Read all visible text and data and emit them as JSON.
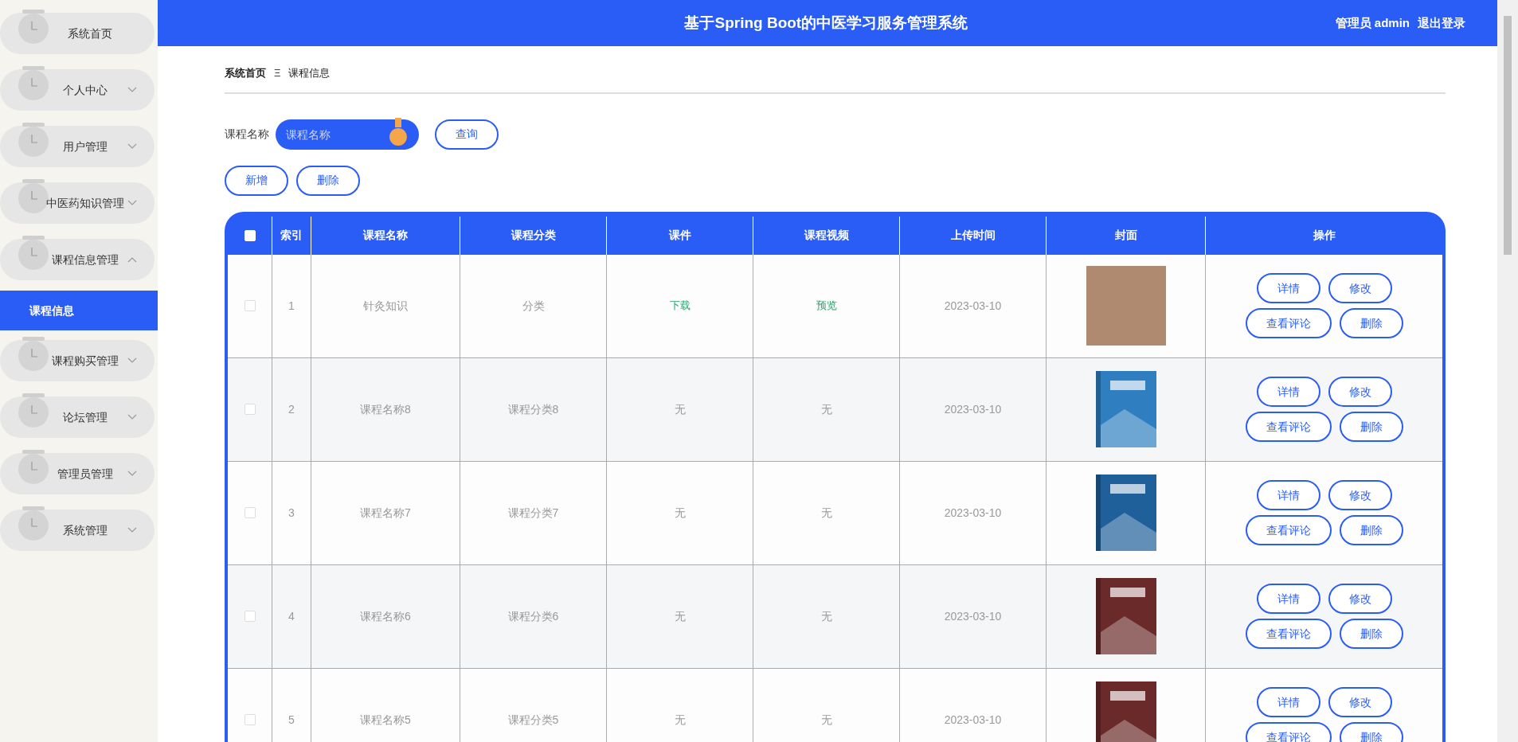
{
  "sidebar": {
    "items": [
      {
        "label": "系统首页",
        "has_children": false
      },
      {
        "label": "个人中心",
        "has_children": true,
        "expanded": false
      },
      {
        "label": "用户管理",
        "has_children": true,
        "expanded": false
      },
      {
        "label": "中医药知识管理",
        "has_children": true,
        "expanded": false
      },
      {
        "label": "课程信息管理",
        "has_children": true,
        "expanded": true,
        "children": [
          {
            "label": "课程信息",
            "selected": true
          }
        ]
      },
      {
        "label": "课程购买管理",
        "has_children": true,
        "expanded": false
      },
      {
        "label": "论坛管理",
        "has_children": true,
        "expanded": false
      },
      {
        "label": "管理员管理",
        "has_children": true,
        "expanded": false
      },
      {
        "label": "系统管理",
        "has_children": true,
        "expanded": false
      }
    ]
  },
  "header": {
    "title": "基于Spring Boot的中医学习服务管理系统",
    "user": "管理员 admin",
    "logout": "退出登录"
  },
  "breadcrumb": {
    "items": [
      "系统首页",
      "课程信息"
    ],
    "separator": "Ξ"
  },
  "search": {
    "label": "课程名称",
    "placeholder": "课程名称",
    "button": "查询"
  },
  "actions": [
    "新增",
    "删除"
  ],
  "table": {
    "header_checked": false,
    "columns": [
      "索引",
      "课程名称",
      "课程分类",
      "课件",
      "课程视频",
      "上传时间",
      "封面",
      "操作"
    ],
    "rows": [
      {
        "checked": false,
        "index": "1",
        "name": "针灸知识",
        "category": "分类",
        "courseware": {
          "kind": "link",
          "text": "下载"
        },
        "video": {
          "kind": "link",
          "text": "预览"
        },
        "date": "2023-03-10",
        "cover": {
          "kind": "photo",
          "color": "#b08a70"
        },
        "buttons": [
          "详情",
          "修改",
          "查看评论",
          "删除"
        ]
      },
      {
        "checked": false,
        "index": "2",
        "name": "课程名称8",
        "category": "课程分类8",
        "courseware": {
          "kind": "text",
          "text": "无"
        },
        "video": {
          "kind": "text",
          "text": "无"
        },
        "date": "2023-03-10",
        "cover": {
          "kind": "book",
          "color": "#2f7fc0"
        },
        "buttons": [
          "详情",
          "修改",
          "查看评论",
          "删除"
        ]
      },
      {
        "checked": false,
        "index": "3",
        "name": "课程名称7",
        "category": "课程分类7",
        "courseware": {
          "kind": "text",
          "text": "无"
        },
        "video": {
          "kind": "text",
          "text": "无"
        },
        "date": "2023-03-10",
        "cover": {
          "kind": "book",
          "color": "#1f5f9a"
        },
        "buttons": [
          "详情",
          "修改",
          "查看评论",
          "删除"
        ]
      },
      {
        "checked": false,
        "index": "4",
        "name": "课程名称6",
        "category": "课程分类6",
        "courseware": {
          "kind": "text",
          "text": "无"
        },
        "video": {
          "kind": "text",
          "text": "无"
        },
        "date": "2023-03-10",
        "cover": {
          "kind": "book",
          "color": "#6b2a2a"
        },
        "buttons": [
          "详情",
          "修改",
          "查看评论",
          "删除"
        ]
      },
      {
        "checked": false,
        "index": "5",
        "name": "课程名称5",
        "category": "课程分类5",
        "courseware": {
          "kind": "text",
          "text": "无"
        },
        "video": {
          "kind": "text",
          "text": "无"
        },
        "date": "2023-03-10",
        "cover": {
          "kind": "book",
          "color": "#6b2a2a"
        },
        "buttons": [
          "详情",
          "修改",
          "查看评论",
          "删除"
        ]
      }
    ]
  }
}
